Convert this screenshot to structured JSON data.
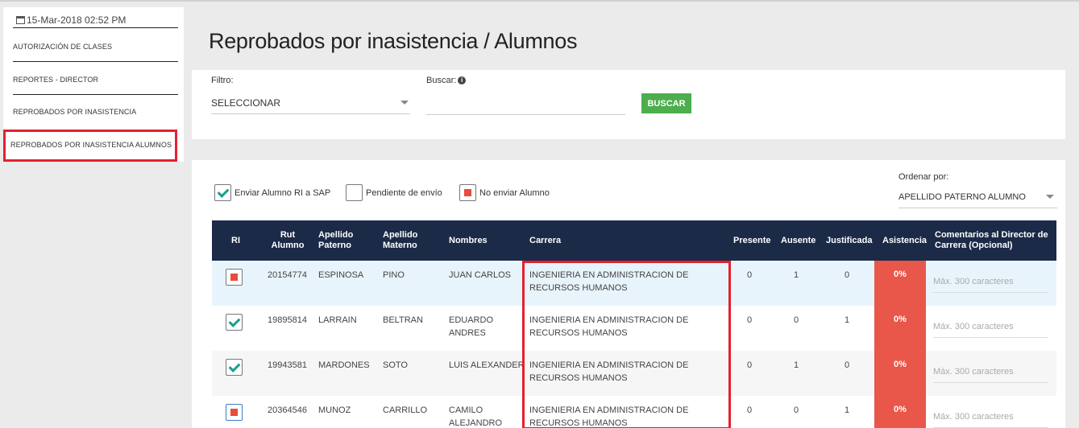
{
  "sidebar": {
    "date": "15-Mar-2018 02:52 PM",
    "items": [
      {
        "label": "AUTORIZACIÓN DE CLASES"
      },
      {
        "label": "REPORTES - DIRECTOR"
      },
      {
        "label": "REPROBADOS POR INASISTENCIA"
      },
      {
        "label": "REPROBADOS POR INASISTENCIA ALUMNOS"
      }
    ]
  },
  "page": {
    "title": "Reprobados por inasistencia / Alumnos"
  },
  "filter": {
    "filtro_label": "Filtro:",
    "filtro_value": "SELECCIONAR",
    "buscar_label": "Buscar:",
    "buscar_value": "",
    "button_label": "BUSCAR"
  },
  "legend": {
    "send": "Enviar Alumno RI a SAP",
    "pending": "Pendiente de envío",
    "no_send": "No enviar Alumno"
  },
  "order": {
    "label": "Ordenar por:",
    "value": "APELLIDO PATERNO ALUMNO"
  },
  "table": {
    "headers": {
      "ri": "RI",
      "rut": "Rut\nAlumno",
      "ap_paterno": "Apellido\nPaterno",
      "ap_materno": "Apellido\nMaterno",
      "nombres": "Nombres",
      "carrera": "Carrera",
      "presente": "Presente",
      "ausente": "Ausente",
      "justificada": "Justificada",
      "asistencia": "Asistencia",
      "comentarios": "Comentarios al Director de\nCarrera (Opcional)"
    },
    "comment_placeholder": "Máx. 300 caracteres",
    "rows": [
      {
        "status": "no",
        "rut": "20154774",
        "ap_paterno": "ESPINOSA",
        "ap_materno": "PINO",
        "nombres": "JUAN CARLOS",
        "carrera": "INGENIERIA EN ADMINISTRACION DE RECURSOS HUMANOS",
        "presente": "0",
        "ausente": "1",
        "justificada": "0",
        "asistencia": "0%"
      },
      {
        "status": "send",
        "rut": "19895814",
        "ap_paterno": "LARRAIN",
        "ap_materno": "BELTRAN",
        "nombres": "EDUARDO ANDRES",
        "carrera": "INGENIERIA EN ADMINISTRACION DE RECURSOS HUMANOS",
        "presente": "0",
        "ausente": "0",
        "justificada": "1",
        "asistencia": "0%"
      },
      {
        "status": "send",
        "rut": "19943581",
        "ap_paterno": "MARDONES",
        "ap_materno": "SOTO",
        "nombres": "LUIS ALEXANDER",
        "carrera": "INGENIERIA EN ADMINISTRACION DE RECURSOS HUMANOS",
        "presente": "0",
        "ausente": "1",
        "justificada": "0",
        "asistencia": "0%"
      },
      {
        "status": "no",
        "rut": "20364546",
        "ap_paterno": "MUNOZ",
        "ap_materno": "CARRILLO",
        "nombres": "CAMILO ALEJANDRO",
        "carrera": "INGENIERIA EN ADMINISTRACION DE RECURSOS HUMANOS",
        "presente": "0",
        "ausente": "0",
        "justificada": "1",
        "asistencia": "0%"
      }
    ]
  },
  "colors": {
    "header_bg": "#1b2a47",
    "asistencia_bg": "#e9564a",
    "button_bg": "#4cae4c",
    "highlight": "#e3212e",
    "check": "#1a9e8f"
  }
}
